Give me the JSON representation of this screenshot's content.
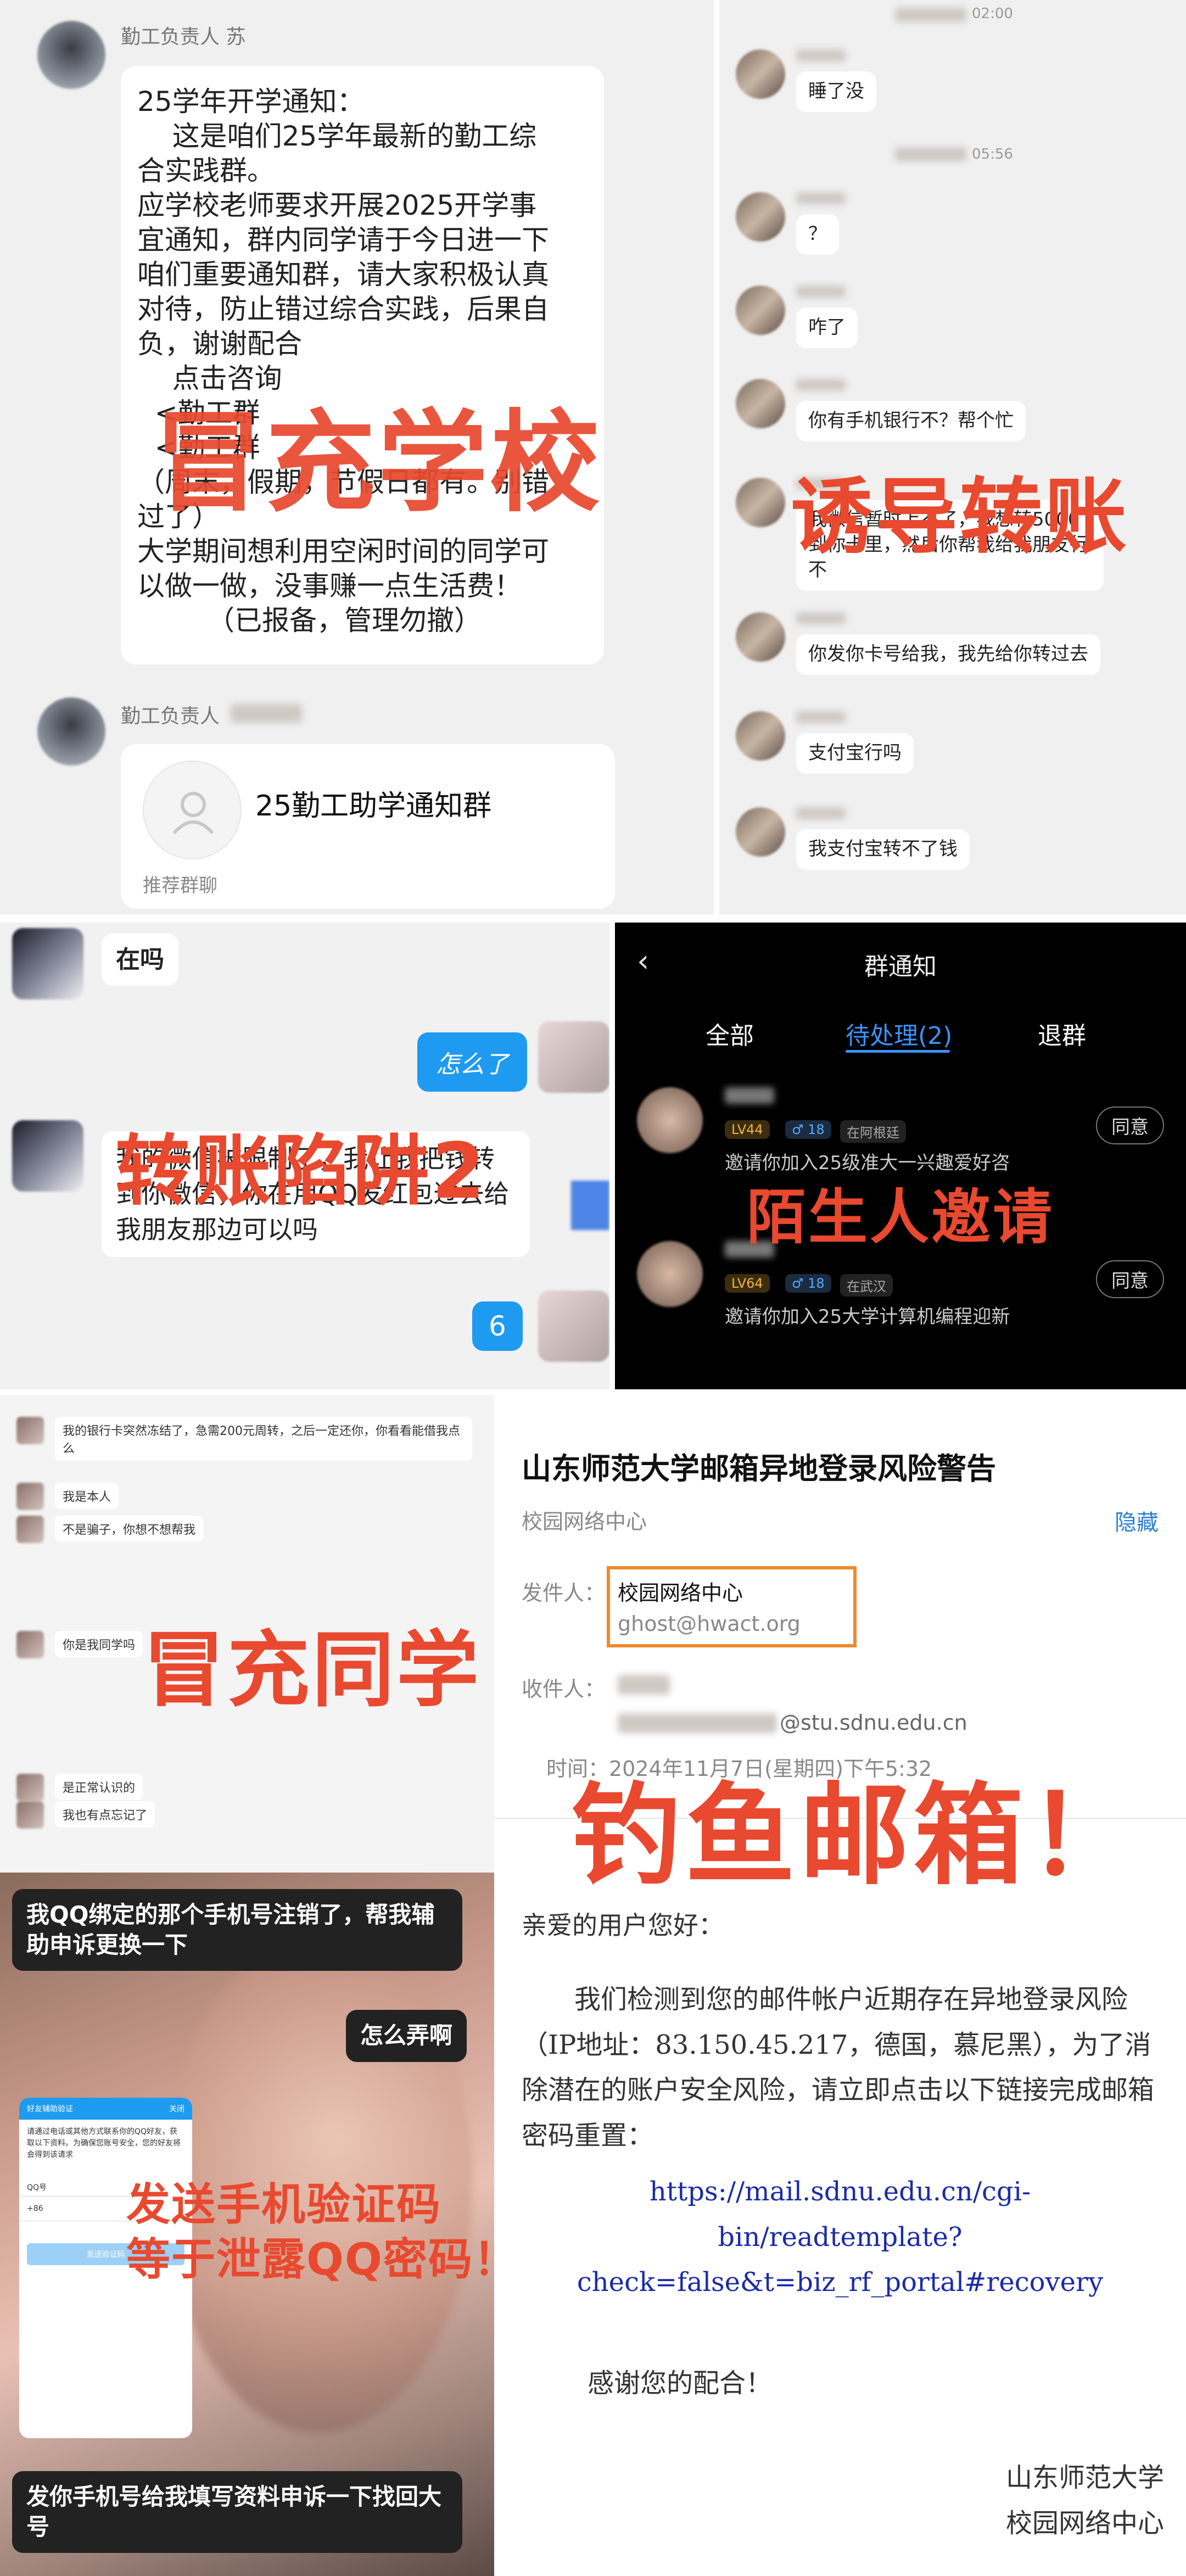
{
  "panel1": {
    "sender_name": "勤工负责人 苏",
    "notice_lines": [
      "25学年开学通知：",
      "    这是咱们25学年最新的勤工综",
      "合实践群。",
      "应学校老师要求开展2025开学事",
      "宜通知，群内同学请于今日进一下",
      "咱们重要通知群，请大家积极认真",
      "对待，防止错过综合实践，后果自",
      "负，谢谢配合",
      "    点击咨询",
      "  <勤工群",
      "  <勤工群",
      "（周末，假期，节假日都有。别错",
      "过了）",
      "大学期间想利用空闲时间的同学可",
      "以做一做，没事赚一点生活费！",
      "        （已报备，管理勿撤）"
    ],
    "sender_name_2": "勤工负责人",
    "group_card_title": "25勤工助学通知群",
    "group_card_tag": "推荐群聊",
    "warning": "冒充学校"
  },
  "panel2": {
    "time1": "02:00",
    "time2": "05:56",
    "messages": [
      "睡了没",
      "？",
      "咋了",
      "你有手机银行不？帮个忙",
      "我微信暂时上不了，我想转5000到你卡里，然后你帮我给我朋友行不",
      "你发你卡号给我，我先给你转过去",
      "支付宝行吗",
      "我支付宝转不了钱"
    ],
    "warning": "诱导转账"
  },
  "panel3": {
    "msg1": "在吗",
    "msg2": "怎么了",
    "msg3": "我的微信被限制了，我让我把钱转到你微信，你在用QQ发红包过去给我朋友那边可以吗",
    "msg4": "6",
    "warning": "转账陷阱2"
  },
  "panel4": {
    "title": "群通知",
    "tabs": [
      "全部",
      "待处理(2)",
      "退群"
    ],
    "items": [
      {
        "level": "LV44",
        "age": "♂ 18",
        "location": "在阿根廷",
        "invite": "邀请你加入25级准大一兴趣爱好咨",
        "button": "同意"
      },
      {
        "level": "LV64",
        "age": "♂ 18",
        "location": "在武汉",
        "invite": "邀请你加入25大学计算机编程迎新",
        "button": "同意"
      }
    ],
    "warning": "陌生人邀请"
  },
  "panel5": {
    "messages": [
      "我的银行卡突然冻结了，急需200元周转，之后一定还你，你看看能借我点么",
      "我是本人",
      "不是骗子，你想不想帮我",
      "你是我同学吗",
      "是正常认识的",
      "我也有点忘记了"
    ],
    "warning": "冒充同学"
  },
  "panel6": {
    "msg1": "我QQ绑定的那个手机号注销了，帮我辅助申诉更换一下",
    "msg2": "怎么弄啊",
    "msg3": "发你手机号给我填写资料申诉一下找回大号",
    "phone_title": "好友辅助验证",
    "phone_close": "关闭",
    "phone_text": "请通过电话或其他方式联系你的QQ好友，获取以下资料。为确保您账号安全，您的好友将会得到该请求",
    "phone_field_label": "QQ号",
    "phone_code": "+86",
    "phone_button": "发送验证码",
    "warning_line1": "发送手机验证码",
    "warning_line2": "等于泄露QQ密码！"
  },
  "panel7": {
    "subject": "山东师范大学邮箱异地登录风险警告",
    "from_label": "校园网络中心",
    "hide": "隐藏",
    "sender_label": "发件人：",
    "sender_name": "校园网络中心",
    "sender_email": "ghost@hwact.org",
    "recipient_label": "收件人：",
    "recipient_domain": "@stu.sdnu.edu.cn",
    "time_label": "时间：2024年11月7日(星期四)下午5:32",
    "greeting": "亲爱的用户您好：",
    "body": "我们检测到您的邮件帐户近期存在异地登录风险（IP地址：83.150.45.217，德国，慕尼黑），为了消除潜在的账户安全风险，请立即点击以下链接完成邮箱密码重置：",
    "link_line1": "https://mail.sdnu.edu.cn/cgi-",
    "link_line2": "bin/readtemplate?",
    "link_line3": "check=false&t=biz_rf_portal#recovery",
    "thanks": "感谢您的配合！",
    "sign1": "山东师范大学",
    "sign2": "校园网络中心",
    "warning": "钓鱼邮箱！"
  },
  "colors": {
    "warning": "#e8492f",
    "qq_blue": "#1e9bf0",
    "link": "#1b2aa8",
    "orange_box": "#f08a2c"
  }
}
